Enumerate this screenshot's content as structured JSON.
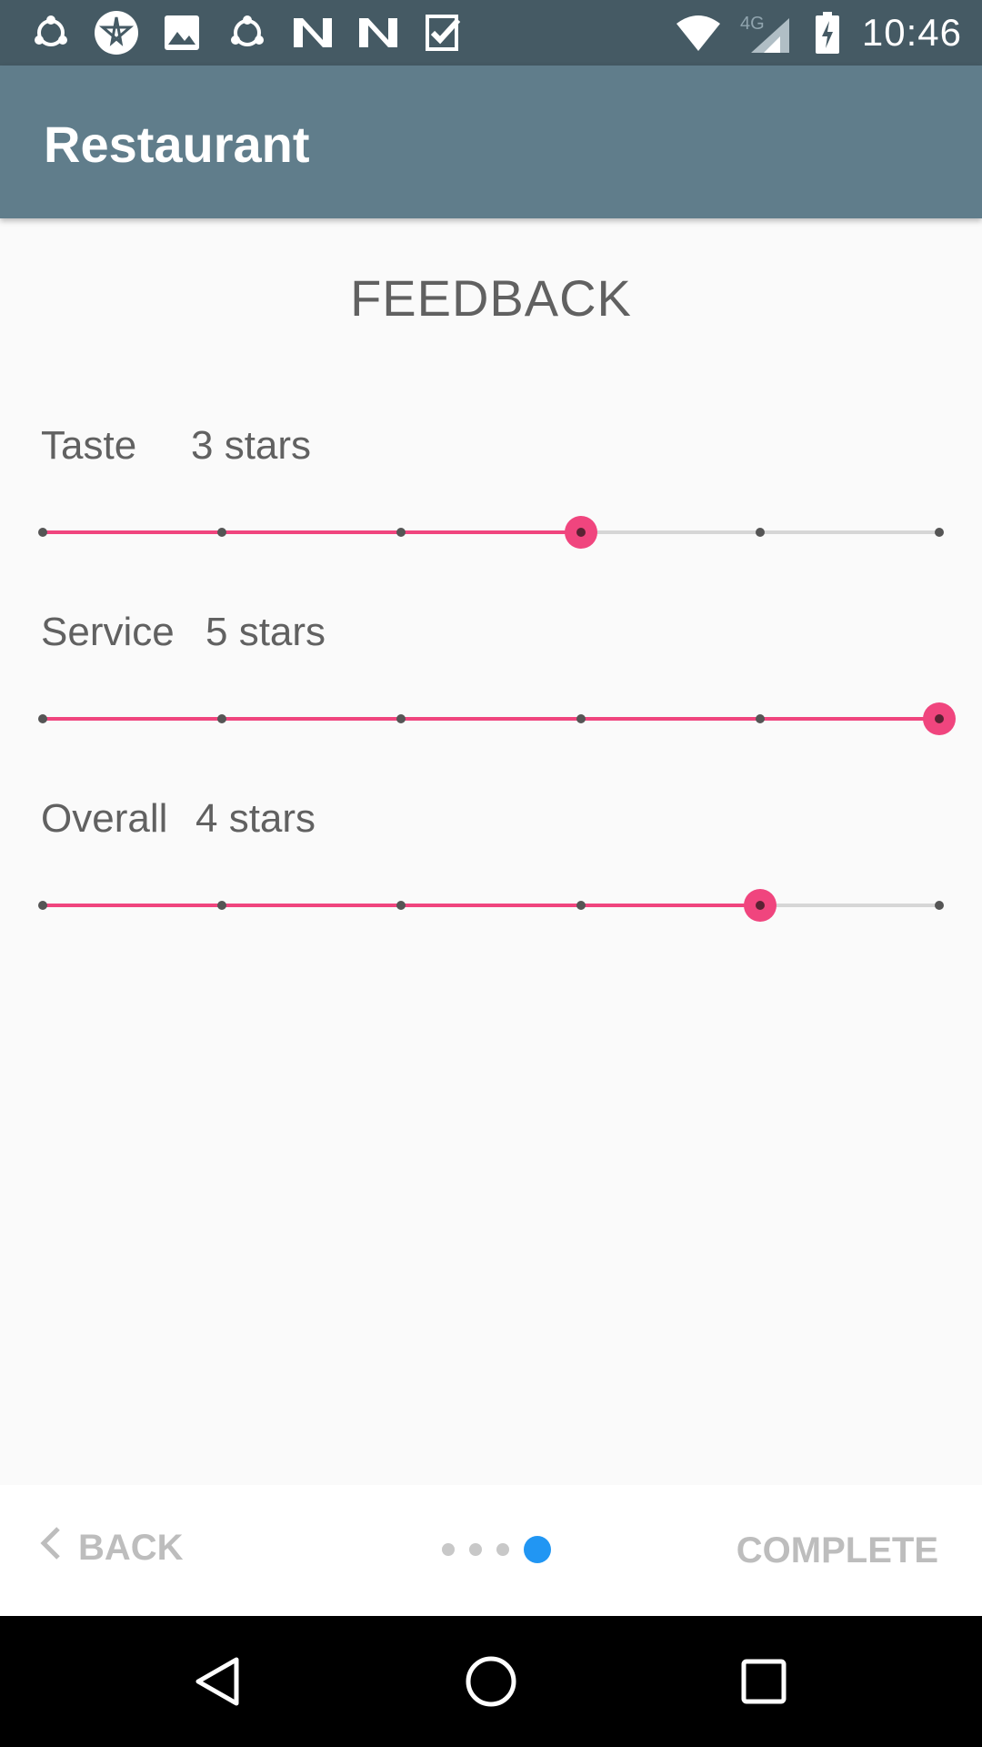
{
  "status_bar": {
    "time": "10:46",
    "network": "4G",
    "notification_icons": [
      "share-icon",
      "star-app-icon",
      "image-icon",
      "share-icon",
      "n-app-icon",
      "n-app-icon",
      "checkmark-app-icon"
    ],
    "system_icons": [
      "wifi-icon",
      "cell-signal-icon",
      "battery-charging-icon"
    ]
  },
  "app_bar": {
    "title": "Restaurant"
  },
  "page": {
    "heading": "FEEDBACK"
  },
  "ratings": [
    {
      "label": "Taste",
      "value_text": "3 stars",
      "value": 3,
      "max": 5
    },
    {
      "label": "Service",
      "value_text": "5 stars",
      "value": 5,
      "max": 5
    },
    {
      "label": "Overall",
      "value_text": "4 stars",
      "value": 4,
      "max": 5
    }
  ],
  "bottom_nav": {
    "back_label": "BACK",
    "complete_label": "COMPLETE",
    "page_count": 4,
    "current_page": 4
  },
  "colors": {
    "status_bar": "#455a64",
    "app_bar": "#607d8b",
    "accent": "#f0457e",
    "pager_active": "#2196f3"
  }
}
